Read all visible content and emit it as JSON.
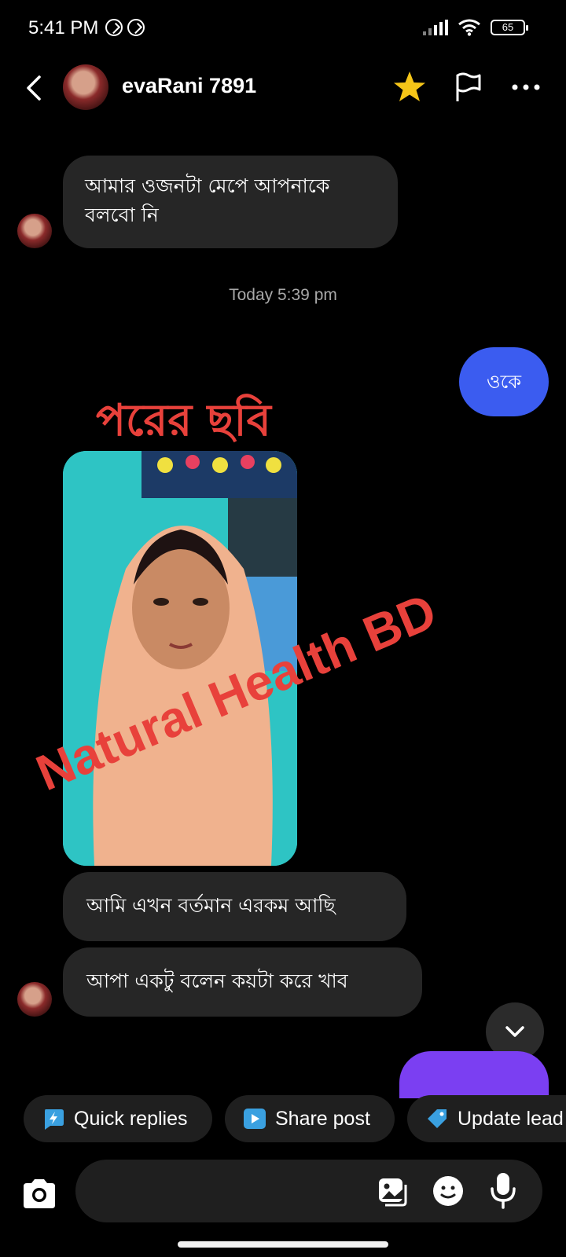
{
  "status_bar": {
    "time": "5:41 PM",
    "battery": "65"
  },
  "header": {
    "contact_name": "evaRani 7891",
    "icons": [
      "back-icon",
      "star-icon",
      "flag-icon",
      "more-icon"
    ],
    "star_color": "#f5c518"
  },
  "messages": {
    "incoming_1": "আমার ওজনটা মেপে আপনাকে বলবো নি",
    "timestamp": "Today 5:39 pm",
    "outgoing_1": "ওকে",
    "overlay_title": "পরের ছবি",
    "watermark": "Natural Health BD",
    "incoming_2": "আমি এখন বর্তমান এরকম আছি",
    "incoming_3": "আপা একটু বলেন কয়টা করে খাব"
  },
  "quick_actions": {
    "quick_replies": "Quick replies",
    "share_post": "Share post",
    "update_lead": "Update lead"
  },
  "composer": {
    "placeholder": ""
  },
  "colors": {
    "outgoing_bubble": "#3b5cf0",
    "incoming_bubble": "#262626",
    "overlay_red": "#e8413b",
    "accent_purple": "#7b3ff2"
  }
}
